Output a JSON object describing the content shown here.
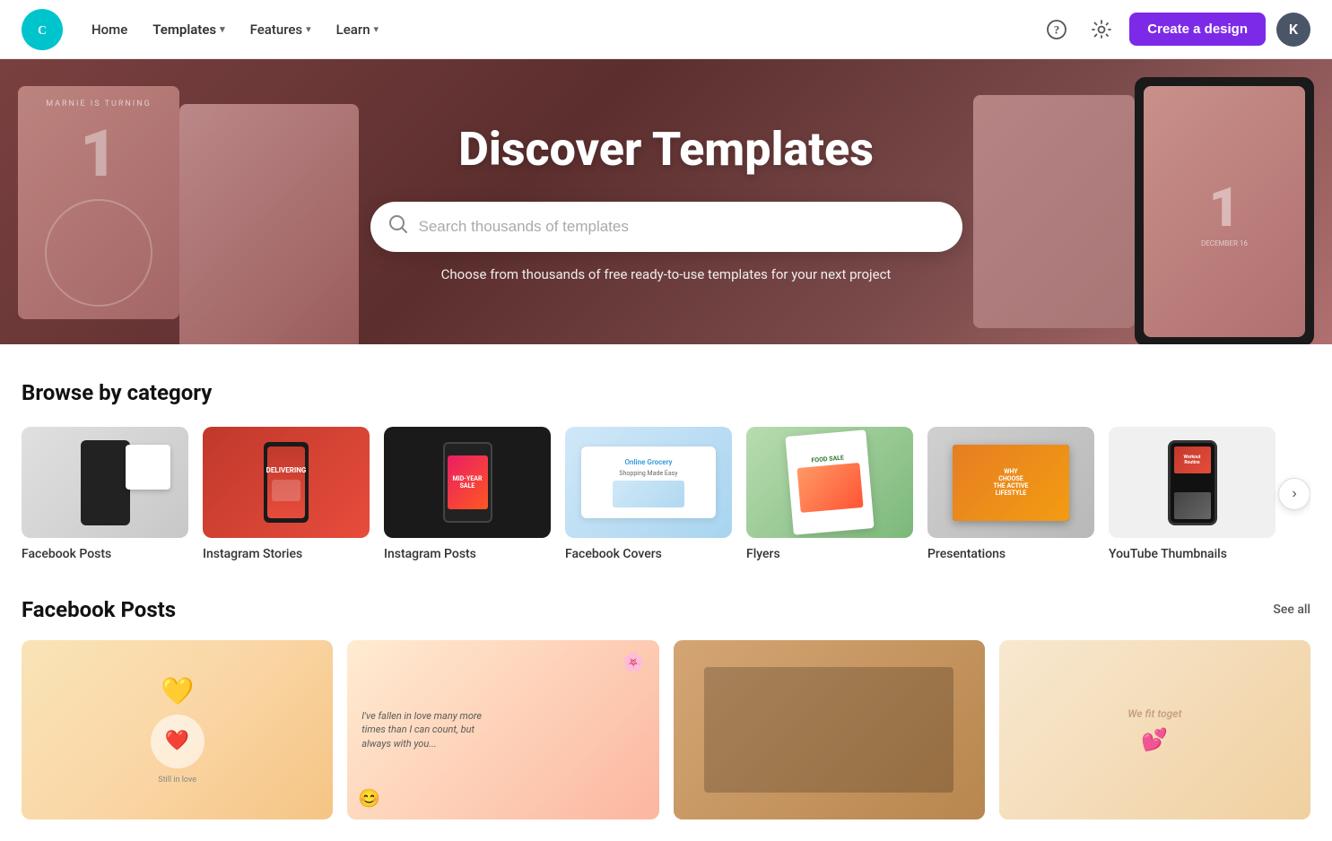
{
  "nav": {
    "logo_alt": "Canva",
    "links": [
      {
        "label": "Home",
        "has_dropdown": false
      },
      {
        "label": "Templates",
        "has_dropdown": true
      },
      {
        "label": "Features",
        "has_dropdown": true
      },
      {
        "label": "Learn",
        "has_dropdown": true
      }
    ],
    "create_button": "Create a design",
    "avatar_letter": "K",
    "help_title": "Help",
    "settings_title": "Settings"
  },
  "hero": {
    "title": "Discover Templates",
    "search_placeholder": "Search thousands of templates",
    "subtitle": "Choose from thousands of free ready-to-use templates for your next project"
  },
  "browse": {
    "section_title": "Browse by category",
    "categories": [
      {
        "label": "Facebook Posts",
        "key": "fb-posts"
      },
      {
        "label": "Instagram Stories",
        "key": "ig-stories"
      },
      {
        "label": "Instagram Posts",
        "key": "ig-posts"
      },
      {
        "label": "Facebook Covers",
        "key": "fb-covers"
      },
      {
        "label": "Flyers",
        "key": "flyers"
      },
      {
        "label": "Presentations",
        "key": "presentations"
      },
      {
        "label": "YouTube Thumbnails",
        "key": "youtube"
      }
    ]
  },
  "facebook_posts": {
    "section_title": "Facebook Posts",
    "see_all_label": "See all",
    "cards": [
      {
        "key": "card1",
        "color_class": "fb-card-1"
      },
      {
        "key": "card2",
        "color_class": "fb-card-2"
      },
      {
        "key": "card3",
        "color_class": "fb-card-3"
      },
      {
        "key": "card4",
        "color_class": "fb-card-4"
      }
    ]
  },
  "icons": {
    "search": "🔍",
    "help": "?",
    "settings": "⚙",
    "chevron_right": "›",
    "chevron_down": "▾"
  }
}
